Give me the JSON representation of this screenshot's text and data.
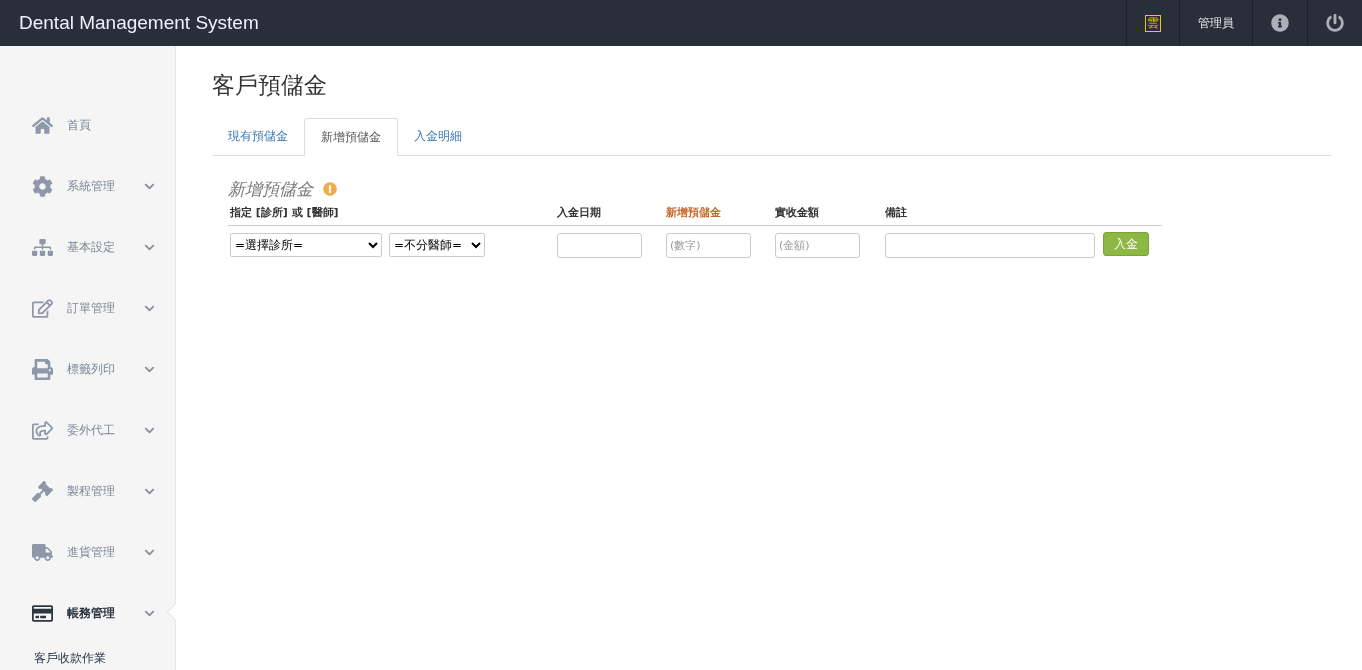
{
  "header": {
    "title": "Dental Management System",
    "badge": "雲",
    "user": "管理員"
  },
  "sidebar": {
    "items": [
      {
        "kind": "link",
        "label": "首頁",
        "selected": false
      },
      {
        "kind": "menu",
        "label": "系統管理",
        "selected": false
      },
      {
        "kind": "menu",
        "label": "基本設定",
        "selected": false
      },
      {
        "kind": "menu",
        "label": "訂單管理",
        "selected": false
      },
      {
        "kind": "menu",
        "label": "標籤列印",
        "selected": false
      },
      {
        "kind": "menu",
        "label": "委外代工",
        "selected": false
      },
      {
        "kind": "menu",
        "label": "製程管理",
        "selected": false
      },
      {
        "kind": "menu",
        "label": "進貨管理",
        "selected": false
      },
      {
        "kind": "menu",
        "label": "帳務管理",
        "selected": true,
        "children": [
          {
            "label": "客戶收款作業"
          }
        ]
      }
    ]
  },
  "page": {
    "title": "客戶預儲金",
    "tabs": [
      {
        "label": "現有預儲金",
        "selected": false
      },
      {
        "label": "新增預儲金",
        "selected": true
      },
      {
        "label": "入金明細",
        "selected": false
      }
    ],
    "section_title": "新增預儲金",
    "columns": [
      {
        "label": "指定 [診所] 或 [醫師]",
        "highlight": false
      },
      {
        "label": "入金日期",
        "highlight": false
      },
      {
        "label": "新增預儲金",
        "highlight": true
      },
      {
        "label": "實收金額",
        "highlight": false
      },
      {
        "label": "備註",
        "highlight": false
      }
    ],
    "clinic_select": "=選擇診所=",
    "doctor_select": "=不分醫師=",
    "amount": {
      "placeholder": "(數字)"
    },
    "received": {
      "placeholder": "(金額)"
    },
    "submit": "入金"
  }
}
